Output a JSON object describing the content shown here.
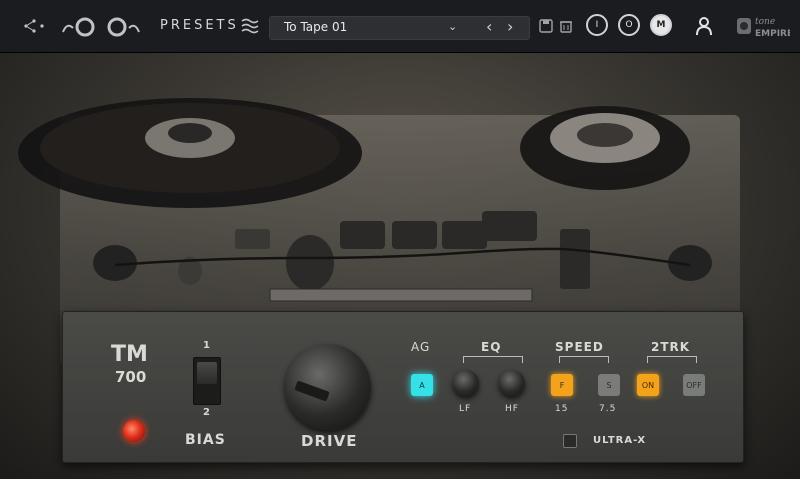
{
  "topbar": {
    "presets_label": "PRESETS",
    "preset_name": "To Tape 01",
    "a_label": "I",
    "b_label": "O",
    "m_label": "M",
    "brand": "tone EMPIRE"
  },
  "panel": {
    "model": "TM",
    "model_num": "700",
    "bias_top": "1",
    "bias_bottom": "2",
    "bias_label": "BIAS",
    "drive_label": "DRIVE",
    "ag_label": "AG",
    "ag_button": "A",
    "eq_label": "EQ",
    "lf_label": "LF",
    "hf_label": "HF",
    "speed_label": "SPEED",
    "speed_f": "F",
    "speed_s": "S",
    "speed_15": "15",
    "speed_75": "7.5",
    "trk_label": "2TRK",
    "trk_on": "ON",
    "trk_off": "OFF",
    "ultrax_label": "ULTRA-X",
    "accent_cyan": "#35e0e6",
    "accent_orange": "#f3a21c"
  }
}
